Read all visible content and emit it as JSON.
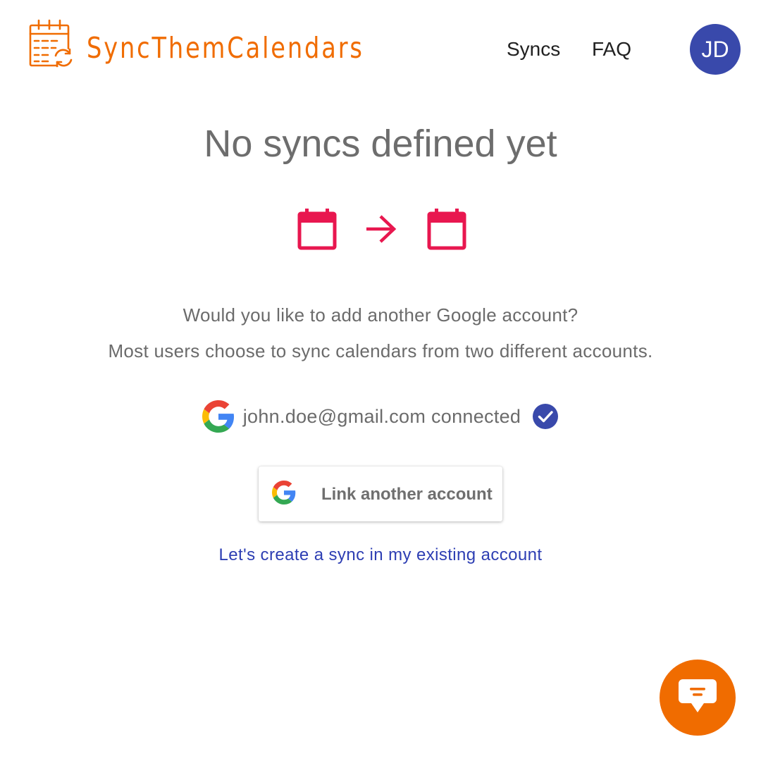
{
  "header": {
    "brand_name": "SyncThemCalendars",
    "nav": [
      {
        "label": "Syncs"
      },
      {
        "label": "FAQ"
      }
    ],
    "avatar_initials": "JD"
  },
  "main": {
    "headline": "No syncs defined yet",
    "question": "Would you like to add another Google account?",
    "hint": "Most users choose to sync calendars from two different accounts.",
    "connected_account": {
      "email_status": "john.doe@gmail.com connected"
    },
    "link_button_label": "Link another account",
    "existing_account_link": "Let's create a sync in my existing account"
  },
  "icons": {
    "logo": "calendar-sync-icon",
    "calendar": "calendar-icon",
    "arrow": "arrow-right-icon",
    "google": "google-g-icon",
    "verified": "check-circle-icon",
    "chat": "chat-bubble-icon"
  },
  "colors": {
    "brand_orange": "#f06c00",
    "accent_pink": "#e8174f",
    "avatar_indigo": "#3949ab",
    "link_blue": "#2d3eb3",
    "text_gray": "#6b6b6b"
  }
}
